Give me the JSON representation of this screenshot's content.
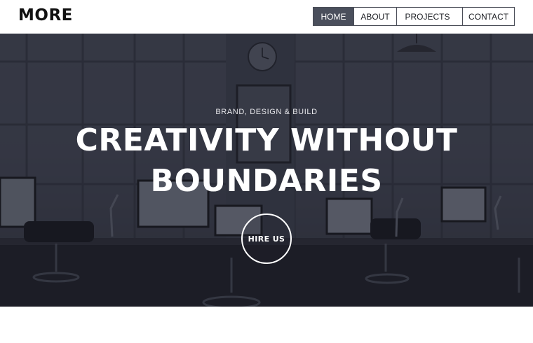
{
  "brand": {
    "logo_text": "MORE"
  },
  "nav": {
    "items": [
      {
        "label": "HOME",
        "active": true
      },
      {
        "label": "ABOUT",
        "active": false
      },
      {
        "label": "PROJECTS",
        "active": false,
        "has_dropdown": true
      },
      {
        "label": "CONTACT",
        "active": false
      }
    ]
  },
  "hero": {
    "subtitle": "BRAND, DESIGN & BUILD",
    "headline": "CREATIVITY WITHOUT BOUNDARIES",
    "cta_label": "HIRE US"
  },
  "colors": {
    "nav_active_bg": "#4a4f5c",
    "hero_overlay": "#2b2e3a",
    "text_light": "#ffffff"
  },
  "icons": {
    "dropdown": "chevron-down-icon"
  }
}
